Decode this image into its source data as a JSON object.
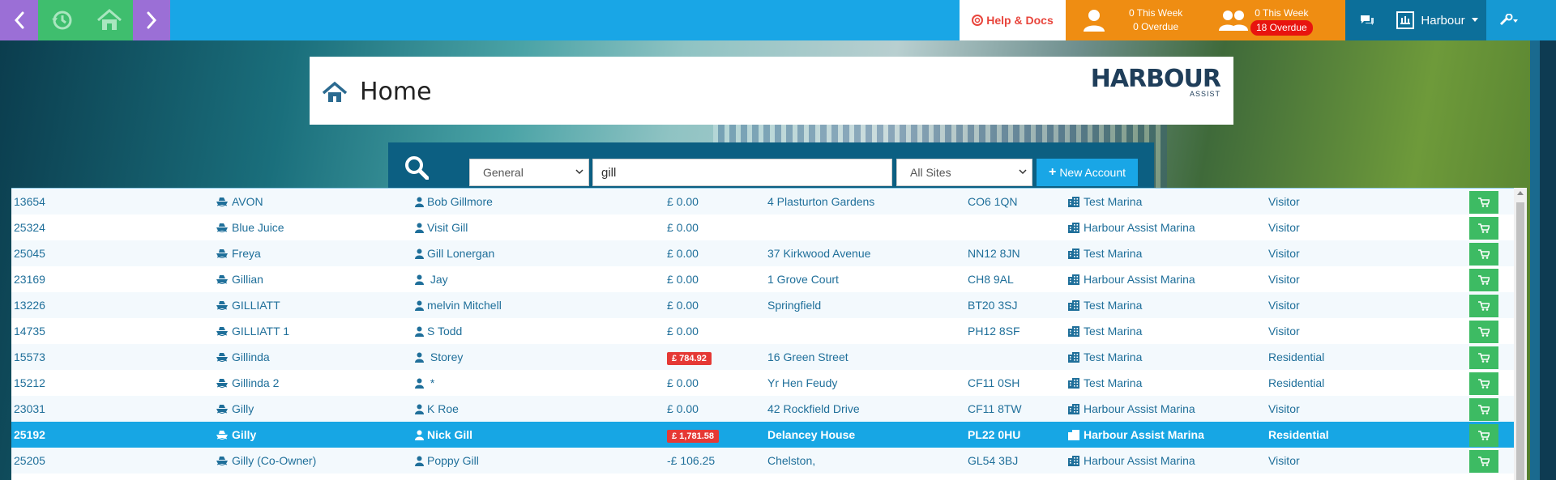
{
  "topbar": {
    "help_label": "Help & Docs",
    "stats_single": {
      "line1": "0 This Week",
      "line2": "0 Overdue"
    },
    "stats_group": {
      "line1": "0 This Week",
      "overdue": "18 Overdue"
    },
    "site_label": "Harbour"
  },
  "header": {
    "title": "Home",
    "logo_main": "HARBOUR",
    "logo_sub": "ASSIST"
  },
  "search": {
    "category": "General",
    "query": "gill",
    "sites": "All Sites",
    "new_account_label": "New Account"
  },
  "colors": {
    "accent": "#19a6e6",
    "orange": "#ef8d12",
    "green": "#3fbe6e",
    "purple": "#9b6fd6",
    "danger": "#e53935"
  },
  "rows": [
    {
      "id": "13654",
      "boat": "AVON",
      "owner": "Bob Gillmore",
      "balance": "£ 0.00",
      "balance_alert": false,
      "address": "4 Plasturton Gardens",
      "postcode": "CO6 1QN",
      "site": "Test Marina",
      "type": "Visitor"
    },
    {
      "id": "25324",
      "boat": "Blue Juice",
      "owner": "Visit Gill",
      "balance": "£ 0.00",
      "balance_alert": false,
      "address": "",
      "postcode": "",
      "site": "Harbour Assist Marina",
      "type": "Visitor"
    },
    {
      "id": "25045",
      "boat": "Freya",
      "owner": "Gill Lonergan",
      "balance": "£ 0.00",
      "balance_alert": false,
      "address": "37 Kirkwood Avenue",
      "postcode": "NN12 8JN",
      "site": "Test Marina",
      "type": "Visitor"
    },
    {
      "id": "23169",
      "boat": "Gillian",
      "owner": " Jay",
      "balance": "£ 0.00",
      "balance_alert": false,
      "address": "1 Grove Court",
      "postcode": "CH8 9AL",
      "site": "Harbour Assist Marina",
      "type": "Visitor"
    },
    {
      "id": "13226",
      "boat": "GILLIATT",
      "owner": "melvin Mitchell",
      "balance": "£ 0.00",
      "balance_alert": false,
      "address": "Springfield",
      "postcode": "BT20 3SJ",
      "site": "Test Marina",
      "type": "Visitor"
    },
    {
      "id": "14735",
      "boat": "GILLIATT 1",
      "owner": "S Todd",
      "balance": "£ 0.00",
      "balance_alert": false,
      "address": "",
      "postcode": "PH12 8SF",
      "site": "Test Marina",
      "type": "Visitor"
    },
    {
      "id": "15573",
      "boat": "Gillinda",
      "owner": " Storey",
      "balance": "£ 784.92",
      "balance_alert": true,
      "address": "16 Green Street",
      "postcode": "",
      "site": "Test Marina",
      "type": "Residential"
    },
    {
      "id": "15212",
      "boat": "Gillinda 2",
      "owner": " *",
      "balance": "£ 0.00",
      "balance_alert": false,
      "address": "Yr Hen Feudy",
      "postcode": "CF11 0SH",
      "site": "Test Marina",
      "type": "Residential"
    },
    {
      "id": "23031",
      "boat": "Gilly",
      "owner": "K Roe",
      "balance": "£ 0.00",
      "balance_alert": false,
      "address": "42 Rockfield Drive",
      "postcode": "CF11 8TW",
      "site": "Harbour Assist Marina",
      "type": "Visitor"
    },
    {
      "id": "25192",
      "boat": "Gilly",
      "owner": "Nick Gill",
      "balance": "£ 1,781.58",
      "balance_alert": true,
      "address": "Delancey House",
      "postcode": "PL22 0HU",
      "site": "Harbour Assist Marina",
      "type": "Residential",
      "selected": true
    },
    {
      "id": "25205",
      "boat": "Gilly (Co-Owner)",
      "owner": "Poppy Gill",
      "balance": "-£ 106.25",
      "balance_alert": false,
      "address": "Chelston,",
      "postcode": "GL54 3BJ",
      "site": "Harbour Assist Marina",
      "type": "Visitor"
    }
  ]
}
